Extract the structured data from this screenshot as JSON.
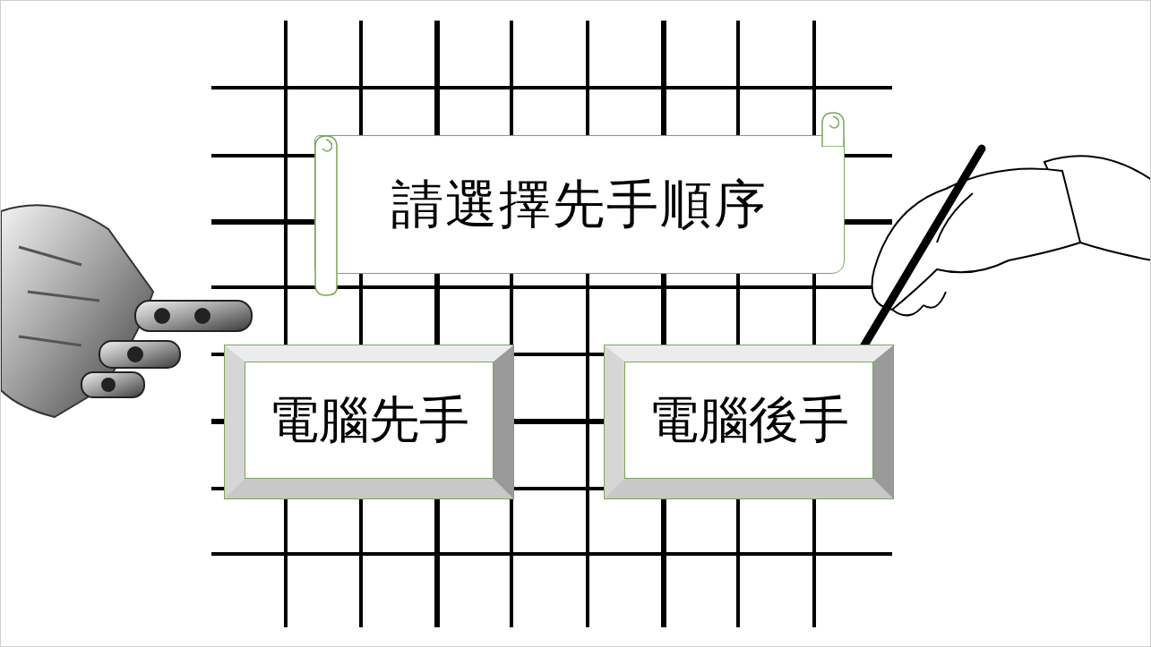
{
  "title": "請選擇先手順序",
  "buttons": [
    {
      "label": "電腦先手"
    },
    {
      "label": "電腦後手"
    }
  ]
}
